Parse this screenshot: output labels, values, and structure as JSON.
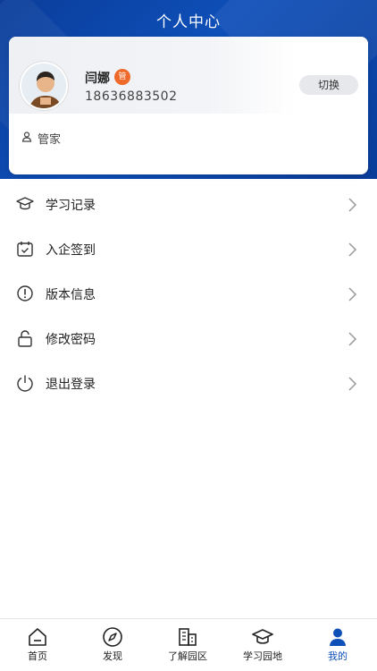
{
  "header": {
    "title": "个人中心"
  },
  "profile": {
    "name": "闫娜",
    "badge": "管",
    "phone": "18636883502",
    "switch_label": "切换",
    "role": "管家"
  },
  "menu": {
    "items": [
      {
        "label": "学习记录",
        "icon": "graduation-cap-icon"
      },
      {
        "label": "入企签到",
        "icon": "calendar-check-icon"
      },
      {
        "label": "版本信息",
        "icon": "info-circle-icon"
      },
      {
        "label": "修改密码",
        "icon": "lock-icon"
      },
      {
        "label": "退出登录",
        "icon": "power-icon"
      }
    ]
  },
  "tabbar": {
    "items": [
      {
        "label": "首页",
        "icon": "home-icon"
      },
      {
        "label": "发现",
        "icon": "compass-icon"
      },
      {
        "label": "了解园区",
        "icon": "buildings-icon"
      },
      {
        "label": "学习园地",
        "icon": "graduation-cap-icon"
      },
      {
        "label": "我的",
        "icon": "user-icon",
        "active": true
      }
    ]
  },
  "colors": {
    "primary": "#0e4fb8",
    "badge": "#ef6a2a",
    "header_dark": "#0a3d9a"
  }
}
